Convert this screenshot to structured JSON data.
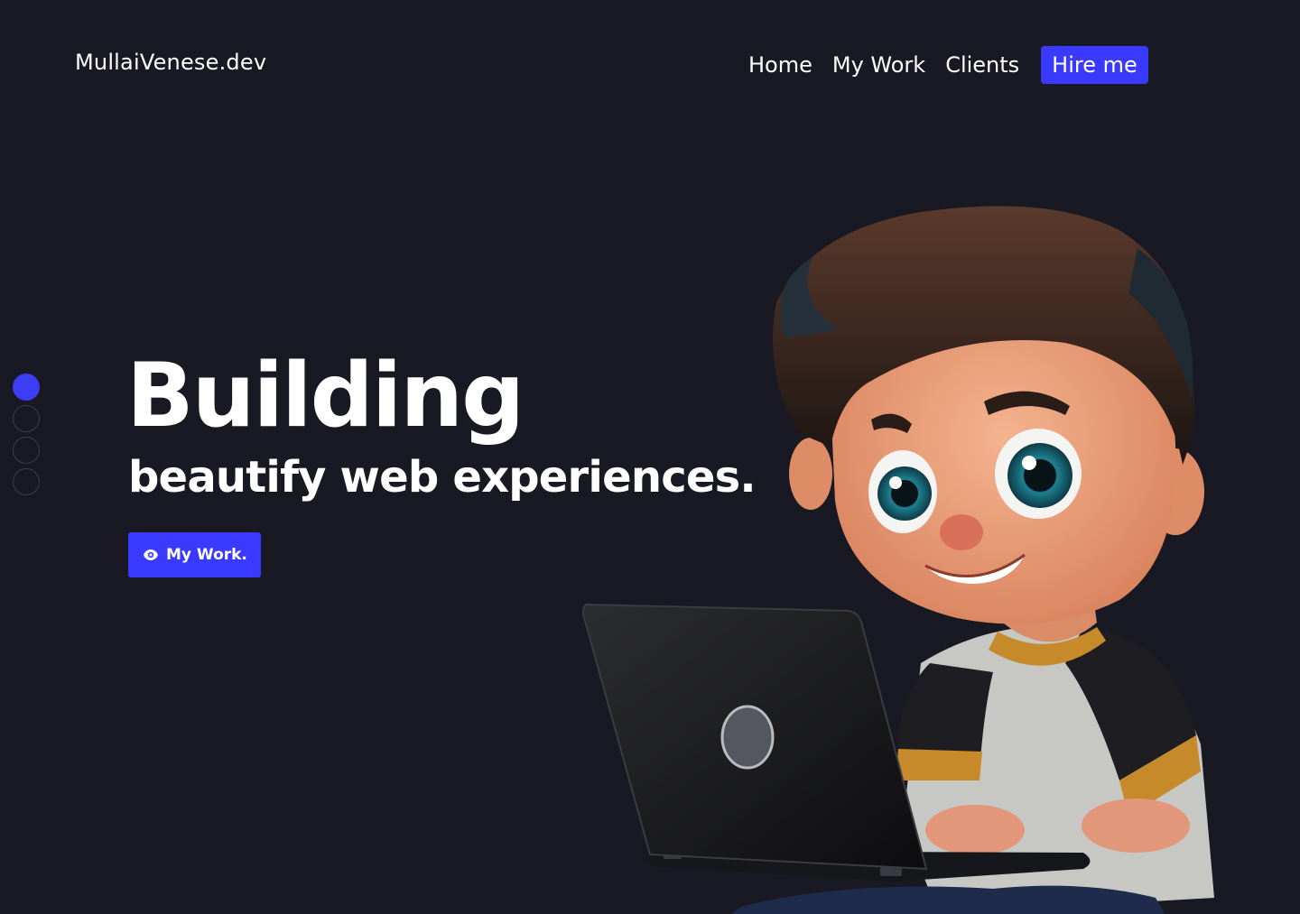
{
  "header": {
    "brand": "MullaiVenese.dev",
    "nav": [
      {
        "label": "Home"
      },
      {
        "label": "My Work"
      },
      {
        "label": "Clients"
      }
    ],
    "hire_label": "Hire me"
  },
  "sidebar": {
    "dots": [
      {
        "active": true
      },
      {
        "active": false
      },
      {
        "active": false
      },
      {
        "active": false
      }
    ]
  },
  "hero": {
    "title": "Building",
    "subtitle": "beautify web experiences.",
    "cta_label": "My Work.",
    "cta_icon": "eye-icon"
  },
  "illustration": {
    "subject": "cartoon-boy-with-laptop-illustration"
  },
  "colors": {
    "background": "#181922",
    "accent": "#3a3aff",
    "text": "#ffffff"
  }
}
